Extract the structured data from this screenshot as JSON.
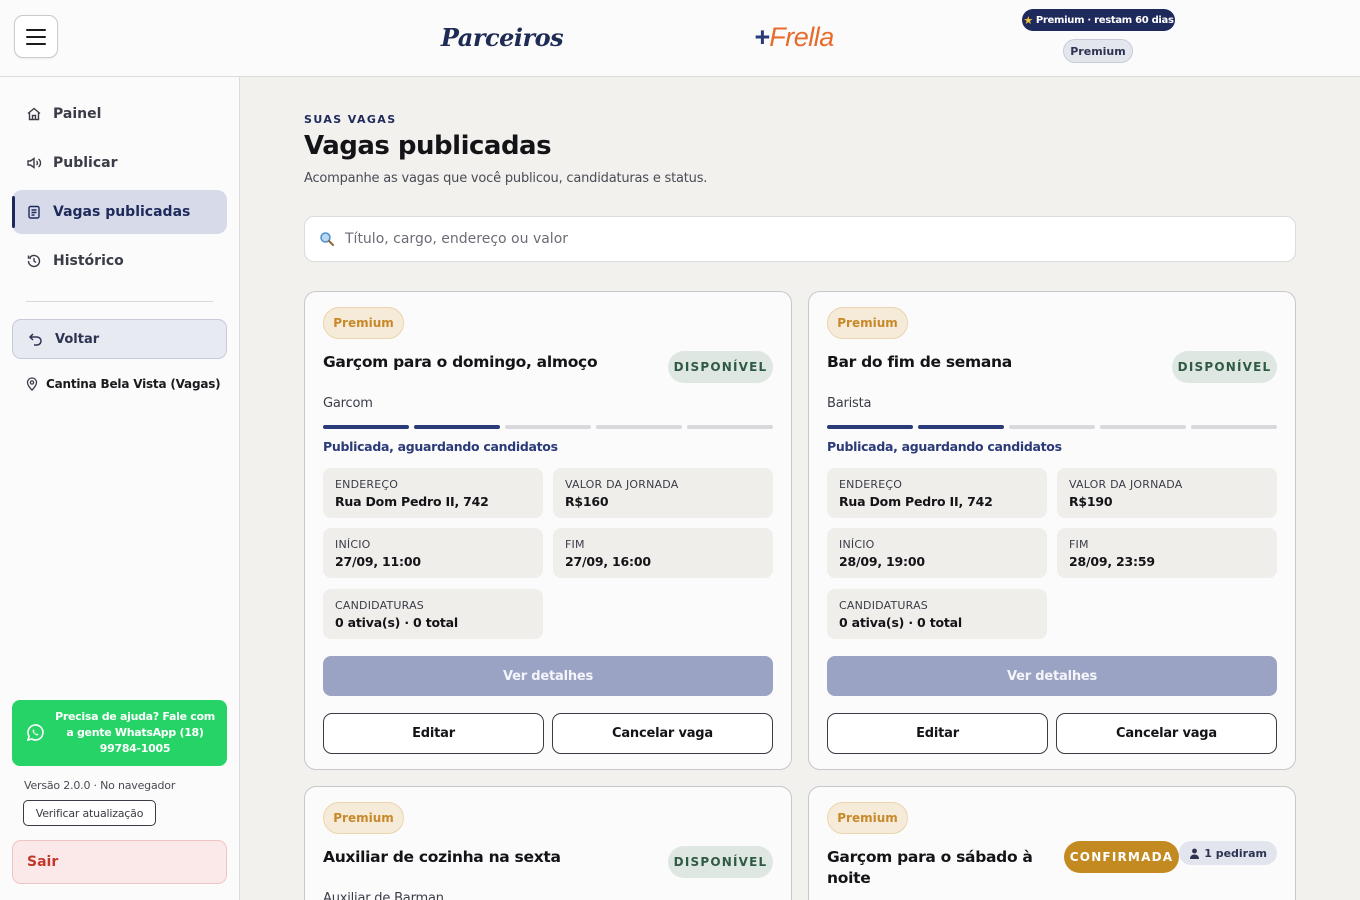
{
  "header": {
    "brand_left": "Parceiros",
    "brand_right_plus": "+",
    "brand_right": "Frella",
    "premium_pill": "Premium · restam 60 dias",
    "premium_chip": "Premium"
  },
  "sidebar": {
    "items": [
      {
        "label": "Painel",
        "icon": "home-icon"
      },
      {
        "label": "Publicar",
        "icon": "megaphone-icon"
      },
      {
        "label": "Vagas publicadas",
        "icon": "clipboard-icon",
        "active": true
      },
      {
        "label": "Histórico",
        "icon": "history-icon"
      }
    ],
    "back_label": "Voltar",
    "place": "Cantina Bela Vista (Vagas)",
    "help_text": "Precisa de ajuda? Fale com a gente WhatsApp (18) 99784-1005",
    "version": "Versão 2.0.0 · No navegador",
    "check_update": "Verificar atualização",
    "logout": "Sair"
  },
  "main": {
    "eyebrow": "SUAS VAGAS",
    "title": "Vagas publicadas",
    "subtitle": "Acompanhe as vagas que você publicou, candidaturas e status.",
    "search_placeholder": "Título, cargo, endereço ou valor"
  },
  "cards": [
    {
      "badge": "Premium",
      "title": "Garçom para o domingo, almoço",
      "status": "DISPONÍVEL",
      "role": "Garcom",
      "progress_steps": 5,
      "progress_done": 2,
      "progress_label": "Publicada, aguardando candidatos",
      "address_label": "ENDEREÇO",
      "address": "Rua Dom Pedro II, 742",
      "value_label": "VALOR DA JORNADA",
      "value": "R$160",
      "start_label": "INÍCIO",
      "start": "27/09, 11:00",
      "end_label": "FIM",
      "end": "27/09, 16:00",
      "apps_label": "CANDIDATURAS",
      "apps": "0 ativa(s) · 0 total",
      "details": "Ver detalhes",
      "edit": "Editar",
      "cancel": "Cancelar vaga"
    },
    {
      "badge": "Premium",
      "title": "Bar do fim de semana",
      "status": "DISPONÍVEL",
      "role": "Barista",
      "progress_steps": 5,
      "progress_done": 2,
      "progress_label": "Publicada, aguardando candidatos",
      "address_label": "ENDEREÇO",
      "address": "Rua Dom Pedro II, 742",
      "value_label": "VALOR DA JORNADA",
      "value": "R$190",
      "start_label": "INÍCIO",
      "start": "28/09, 19:00",
      "end_label": "FIM",
      "end": "28/09, 23:59",
      "apps_label": "CANDIDATURAS",
      "apps": "0 ativa(s) · 0 total",
      "details": "Ver detalhes",
      "edit": "Editar",
      "cancel": "Cancelar vaga"
    },
    {
      "badge": "Premium",
      "title": "Auxiliar de cozinha na sexta",
      "status": "DISPONÍVEL",
      "role": "Auxiliar de Barman"
    },
    {
      "badge": "Premium",
      "title": "Garçom para o sábado à noite",
      "status": "CONFIRMADA",
      "requested": "1 pediram"
    }
  ]
}
